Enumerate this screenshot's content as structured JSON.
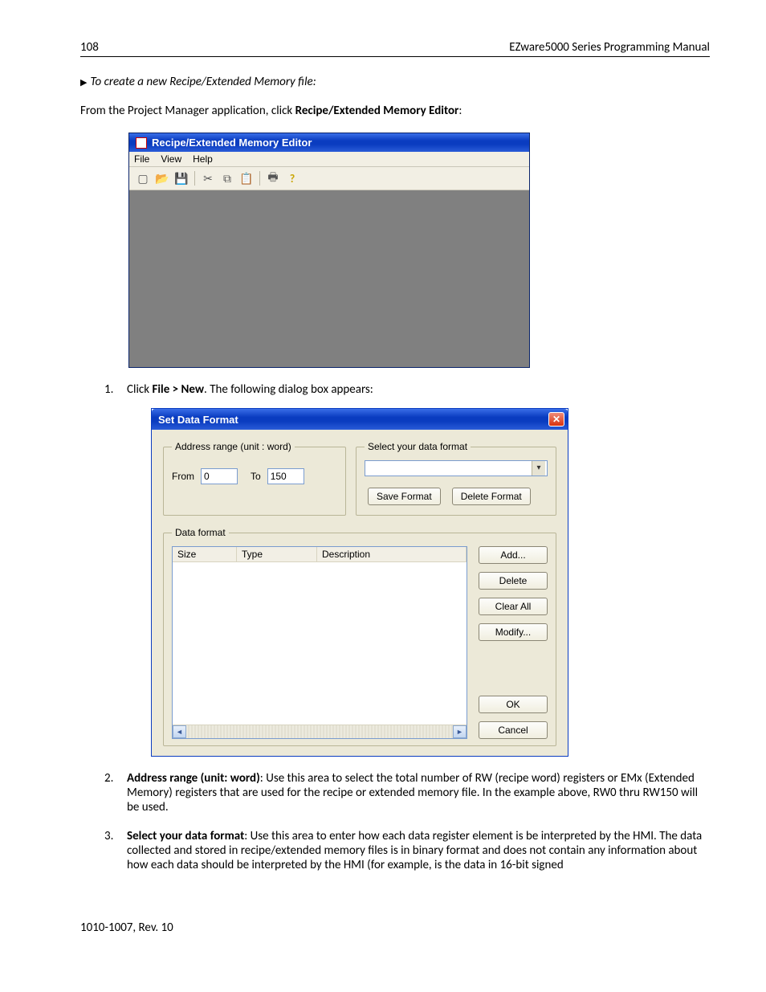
{
  "header": {
    "page_no": "108",
    "title": "EZware5000 Series Programming Manual"
  },
  "subheading": "To create a new Recipe/Extended Memory file:",
  "intro_pre": "From the Project Manager application, click ",
  "intro_bold": "Recipe/Extended Memory Editor",
  "intro_post": ":",
  "win1": {
    "title": "Recipe/Extended Memory Editor",
    "menu": {
      "file": "File",
      "view": "View",
      "help": "Help"
    }
  },
  "step1_pre": "Click ",
  "step1_bold": "File > New",
  "step1_post": ". The following dialog box appears:",
  "dlg": {
    "title": "Set Data Format",
    "addr_legend": "Address range (unit : word)",
    "from_label": "From",
    "from_value": "0",
    "to_label": "To",
    "to_value": "150",
    "sel_legend": "Select your data format",
    "save_format": "Save Format",
    "delete_format": "Delete Format",
    "data_legend": "Data format",
    "col_size": "Size",
    "col_type": "Type",
    "col_desc": "Description",
    "btn_add": "Add...",
    "btn_delete": "Delete",
    "btn_clear": "Clear All",
    "btn_modify": "Modify...",
    "btn_ok": "OK",
    "btn_cancel": "Cancel"
  },
  "step2_bold": "Address range (unit: word)",
  "step2_text": ": Use this area to select the total number of RW (recipe word) registers or EMx (Extended Memory) registers that are used for the recipe or extended memory file. In the example above, RW0 thru RW150 will be used.",
  "step3_bold": "Select your data format",
  "step3_text": ": Use this area to enter how each data register element is be interpreted by the HMI. The data collected and stored in recipe/extended memory files is in binary format and does not contain any information about how each data should be interpreted by the HMI (for example, is the data in 16-bit signed",
  "footer": "1010-1007, Rev. 10"
}
